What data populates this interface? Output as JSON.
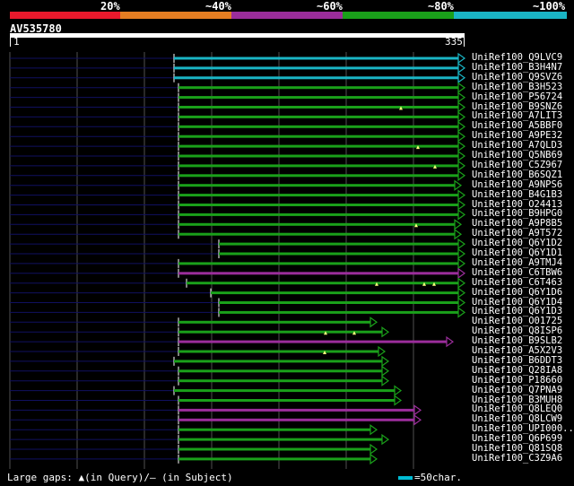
{
  "legend": {
    "labels": [
      "20%",
      "~40%",
      "~60%",
      "~80%",
      "~100%"
    ],
    "colors": [
      "#e8192c",
      "#e67e22",
      "#9b2d9b",
      "#1aa01a",
      "#1ab5c5"
    ]
  },
  "query": {
    "id": "AV535780",
    "start": "1",
    "end": "335"
  },
  "colors": {
    "cyan": "#1ab5c5",
    "green": "#1aa01a",
    "purple": "#9b2d9b",
    "navy": "#101060",
    "gridline": "#505050"
  },
  "hits": [
    {
      "label": "UniRef100_Q9LVC9",
      "color": "cyan"
    },
    {
      "label": "UniRef100_B3H4N7",
      "color": "cyan"
    },
    {
      "label": "UniRef100_Q9SVZ6",
      "color": "cyan"
    },
    {
      "label": "UniRef100_B3H523",
      "color": "green"
    },
    {
      "label": "UniRef100_P56724",
      "color": "green"
    },
    {
      "label": "UniRef100_B9SNZ6",
      "color": "green"
    },
    {
      "label": "UniRef100_A7LIT3",
      "color": "green"
    },
    {
      "label": "UniRef100_A5BBF0",
      "color": "green"
    },
    {
      "label": "UniRef100_A9PE32",
      "color": "green"
    },
    {
      "label": "UniRef100_A7QLD3",
      "color": "green"
    },
    {
      "label": "UniRef100_Q5NB69",
      "color": "green"
    },
    {
      "label": "UniRef100_C5Z967",
      "color": "green"
    },
    {
      "label": "UniRef100_B6SQZ1",
      "color": "green"
    },
    {
      "label": "UniRef100_A9NPS6",
      "color": "green"
    },
    {
      "label": "UniRef100_B4G1B3",
      "color": "green"
    },
    {
      "label": "UniRef100_O24413",
      "color": "green"
    },
    {
      "label": "UniRef100_B9HPG0",
      "color": "green"
    },
    {
      "label": "UniRef100_A9P8B5",
      "color": "green"
    },
    {
      "label": "UniRef100_A9T572",
      "color": "green"
    },
    {
      "label": "UniRef100_Q6Y1D2",
      "color": "green"
    },
    {
      "label": "UniRef100_Q6Y1D1",
      "color": "green"
    },
    {
      "label": "UniRef100_A9TMJ4",
      "color": "green"
    },
    {
      "label": "UniRef100_C6TBW6",
      "color": "purple"
    },
    {
      "label": "UniRef100_C6T463",
      "color": "green"
    },
    {
      "label": "UniRef100_Q6Y1D6",
      "color": "green"
    },
    {
      "label": "UniRef100_Q6Y1D4",
      "color": "green"
    },
    {
      "label": "UniRef100_Q6Y1D3",
      "color": "green"
    },
    {
      "label": "UniRef100_O01725",
      "color": "green"
    },
    {
      "label": "UniRef100_Q8ISP6",
      "color": "green"
    },
    {
      "label": "UniRef100_B9SLB2",
      "color": "purple"
    },
    {
      "label": "UniRef100_A5X2V3",
      "color": "green"
    },
    {
      "label": "UniRef100_B6DDT3",
      "color": "green"
    },
    {
      "label": "UniRef100_Q28IA8",
      "color": "green"
    },
    {
      "label": "UniRef100_P18660",
      "color": "green"
    },
    {
      "label": "UniRef100_Q7PNA9",
      "color": "green"
    },
    {
      "label": "UniRef100_B3MUH8",
      "color": "green"
    },
    {
      "label": "UniRef100_Q8LEQ0",
      "color": "purple"
    },
    {
      "label": "UniRef100_Q8LCW9",
      "color": "purple"
    },
    {
      "label": "UniRef100_UPI000..",
      "color": "green"
    },
    {
      "label": "UniRef100_Q6P699",
      "color": "green"
    },
    {
      "label": "UniRef100_Q81SQ8",
      "color": "green"
    },
    {
      "label": "UniRef100_C3Z9A6",
      "color": "green"
    }
  ],
  "footer": {
    "text": "Large gaps: ▲(in Query)/– (in Subject)",
    "scale_text": "=50char."
  }
}
